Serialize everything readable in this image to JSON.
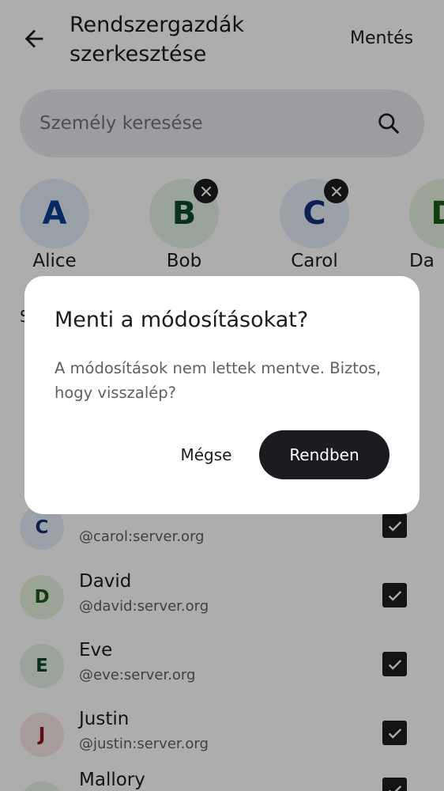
{
  "header": {
    "title": "Rendszergazdák szerkesztése",
    "save_label": "Mentés"
  },
  "search": {
    "placeholder": "Személy keresése"
  },
  "selected": [
    {
      "initial": "A",
      "name": "Alice",
      "bg": "#e4ecf7",
      "fg": "#0b3d91",
      "removable": false
    },
    {
      "initial": "B",
      "name": "Bob",
      "bg": "#e3f1e6",
      "fg": "#0c4a2a",
      "removable": true
    },
    {
      "initial": "C",
      "name": "Carol",
      "bg": "#e6ecf7",
      "fg": "#162f78",
      "removable": true
    },
    {
      "initial": "D",
      "name": "Da",
      "bg": "#e6f2df",
      "fg": "#1e5a16",
      "removable": false
    }
  ],
  "section": {
    "label": "S"
  },
  "users": [
    {
      "initial": "C",
      "name": "",
      "uid": "@carol:server.org",
      "bg": "#e6ecf7",
      "fg": "#162f78",
      "checked": true
    },
    {
      "initial": "D",
      "name": "David",
      "uid": "@david:server.org",
      "bg": "#e6f2df",
      "fg": "#1e5a16",
      "checked": true
    },
    {
      "initial": "E",
      "name": "Eve",
      "uid": "@eve:server.org",
      "bg": "#e3f1e6",
      "fg": "#0c4a2a",
      "checked": true
    },
    {
      "initial": "J",
      "name": "Justin",
      "uid": "@justin:server.org",
      "bg": "#f5e6e4",
      "fg": "#8a1414",
      "checked": true
    },
    {
      "initial": "M",
      "name": "Mallory",
      "uid": "",
      "bg": "#e3f1e6",
      "fg": "#0c4a2a",
      "checked": true
    }
  ],
  "dialog": {
    "title": "Menti a módosításokat?",
    "body": "A módosítások nem lettek mentve. Biztos, hogy visszalép?",
    "cancel_label": "Mégse",
    "ok_label": "Rendben"
  },
  "colors": {
    "primary": "#1b1c1f",
    "surface": "#ffffff",
    "search_bg": "#e7e8ee",
    "scrim": "rgba(0,0,0,0.32)"
  },
  "icons": {
    "back": "arrow-left-icon",
    "search": "magnifier-icon",
    "remove": "close-icon",
    "check": "checkmark-icon"
  }
}
